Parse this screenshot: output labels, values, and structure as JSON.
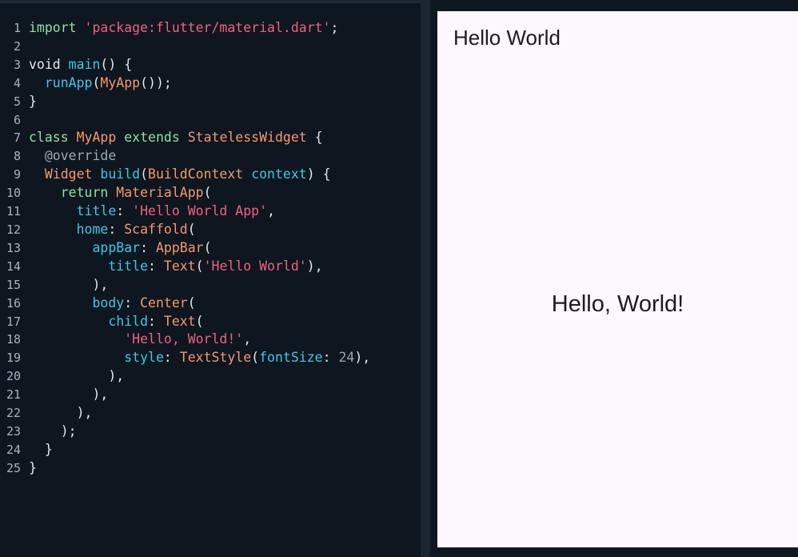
{
  "editor": {
    "lines": [
      {
        "n": "1",
        "parts": [
          [
            "kw",
            "import"
          ],
          [
            "p",
            " "
          ],
          [
            "str",
            "'package:flutter/material.dart'"
          ],
          [
            "p",
            ";"
          ]
        ]
      },
      {
        "n": "2",
        "parts": []
      },
      {
        "n": "3",
        "parts": [
          [
            "p",
            "void "
          ],
          [
            "fn",
            "main"
          ],
          [
            "p",
            "() {"
          ]
        ]
      },
      {
        "n": "4",
        "parts": [
          [
            "p",
            "  "
          ],
          [
            "fn",
            "runApp"
          ],
          [
            "p",
            "("
          ],
          [
            "cls",
            "MyApp"
          ],
          [
            "p",
            "());"
          ]
        ]
      },
      {
        "n": "5",
        "parts": [
          [
            "p",
            "}"
          ]
        ]
      },
      {
        "n": "6",
        "parts": []
      },
      {
        "n": "7",
        "parts": [
          [
            "kw",
            "class"
          ],
          [
            "p",
            " "
          ],
          [
            "cls",
            "MyApp"
          ],
          [
            "p",
            " "
          ],
          [
            "kw",
            "extends"
          ],
          [
            "p",
            " "
          ],
          [
            "cls",
            "StatelessWidget"
          ],
          [
            "p",
            " {"
          ]
        ]
      },
      {
        "n": "8",
        "parts": [
          [
            "p",
            "  "
          ],
          [
            "cmt",
            "@override"
          ]
        ]
      },
      {
        "n": "9",
        "parts": [
          [
            "p",
            "  "
          ],
          [
            "cls",
            "Widget"
          ],
          [
            "p",
            " "
          ],
          [
            "fn",
            "build"
          ],
          [
            "p",
            "("
          ],
          [
            "cls",
            "BuildContext"
          ],
          [
            "p",
            " "
          ],
          [
            "prop",
            "context"
          ],
          [
            "p",
            ") {"
          ]
        ]
      },
      {
        "n": "10",
        "parts": [
          [
            "p",
            "    "
          ],
          [
            "kw",
            "return"
          ],
          [
            "p",
            " "
          ],
          [
            "cls",
            "MaterialApp"
          ],
          [
            "p",
            "("
          ]
        ]
      },
      {
        "n": "11",
        "parts": [
          [
            "p",
            "      "
          ],
          [
            "prop",
            "title"
          ],
          [
            "p",
            ": "
          ],
          [
            "str",
            "'Hello World App'"
          ],
          [
            "p",
            ","
          ]
        ]
      },
      {
        "n": "12",
        "parts": [
          [
            "p",
            "      "
          ],
          [
            "prop",
            "home"
          ],
          [
            "p",
            ": "
          ],
          [
            "cls",
            "Scaffold"
          ],
          [
            "p",
            "("
          ]
        ]
      },
      {
        "n": "13",
        "parts": [
          [
            "p",
            "        "
          ],
          [
            "prop",
            "appBar"
          ],
          [
            "p",
            ": "
          ],
          [
            "cls",
            "AppBar"
          ],
          [
            "p",
            "("
          ]
        ]
      },
      {
        "n": "14",
        "parts": [
          [
            "p",
            "          "
          ],
          [
            "prop",
            "title"
          ],
          [
            "p",
            ": "
          ],
          [
            "cls",
            "Text"
          ],
          [
            "p",
            "("
          ],
          [
            "str",
            "'Hello World'"
          ],
          [
            "p",
            "),"
          ]
        ]
      },
      {
        "n": "15",
        "parts": [
          [
            "p",
            "        ),"
          ]
        ]
      },
      {
        "n": "16",
        "parts": [
          [
            "p",
            "        "
          ],
          [
            "prop",
            "body"
          ],
          [
            "p",
            ": "
          ],
          [
            "cls",
            "Center"
          ],
          [
            "p",
            "("
          ]
        ]
      },
      {
        "n": "17",
        "parts": [
          [
            "p",
            "          "
          ],
          [
            "prop",
            "child"
          ],
          [
            "p",
            ": "
          ],
          [
            "cls",
            "Text"
          ],
          [
            "p",
            "("
          ]
        ]
      },
      {
        "n": "18",
        "parts": [
          [
            "p",
            "            "
          ],
          [
            "str",
            "'Hello, World!'"
          ],
          [
            "p",
            ","
          ]
        ]
      },
      {
        "n": "19",
        "parts": [
          [
            "p",
            "            "
          ],
          [
            "prop",
            "style"
          ],
          [
            "p",
            ": "
          ],
          [
            "cls",
            "TextStyle"
          ],
          [
            "p",
            "("
          ],
          [
            "prop",
            "fontSize"
          ],
          [
            "p",
            ": "
          ],
          [
            "num",
            "24"
          ],
          [
            "p",
            "),"
          ]
        ]
      },
      {
        "n": "20",
        "parts": [
          [
            "p",
            "          ),"
          ]
        ]
      },
      {
        "n": "21",
        "parts": [
          [
            "p",
            "        ),"
          ]
        ]
      },
      {
        "n": "22",
        "parts": [
          [
            "p",
            "      ),"
          ]
        ]
      },
      {
        "n": "23",
        "parts": [
          [
            "p",
            "    );"
          ]
        ]
      },
      {
        "n": "24",
        "parts": [
          [
            "p",
            "  }"
          ]
        ]
      },
      {
        "n": "25",
        "parts": [
          [
            "p",
            "}"
          ]
        ]
      }
    ]
  },
  "preview": {
    "appbar_title": "Hello World",
    "body_text": "Hello, World!"
  }
}
